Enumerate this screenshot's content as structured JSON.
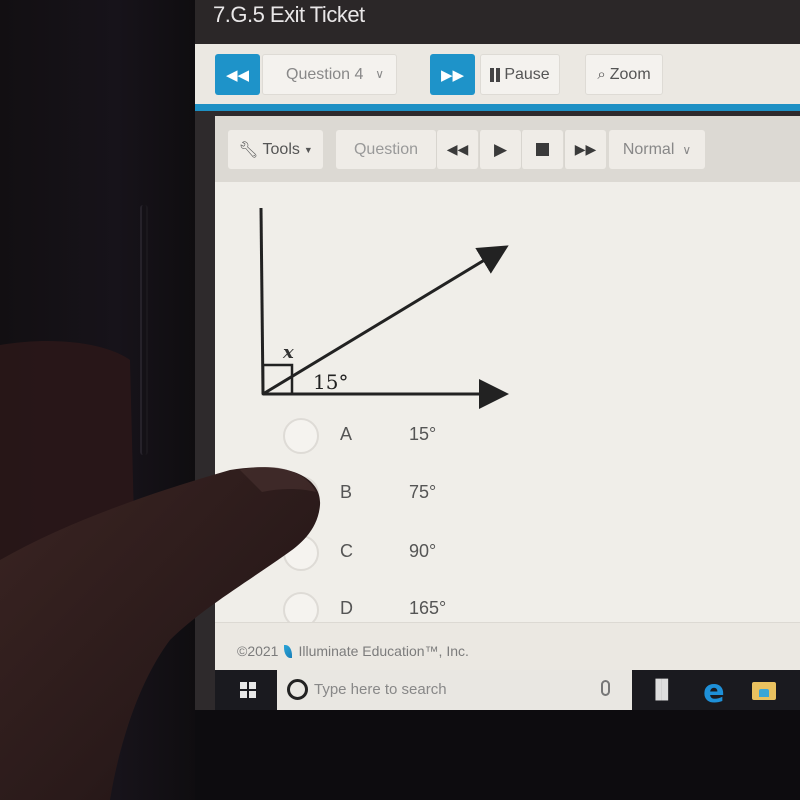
{
  "window": {
    "title": "7.G.5 Exit Ticket"
  },
  "nav": {
    "prev_icon": "double-left-arrow",
    "question_select": "Question 4",
    "next_icon": "double-right-arrow",
    "pause_label": "Pause",
    "zoom_label": "Zoom"
  },
  "toolbar": {
    "tools_label": "Tools",
    "question_label": "Question",
    "rewind_icon": "◀◀",
    "play_icon": "▶",
    "fast_forward_icon": "▶▶",
    "speed_select": "Normal"
  },
  "question": {
    "diagram": {
      "unknown_label": "x",
      "given_angle_label": "15°",
      "right_angle_marker": true
    },
    "choices": [
      {
        "letter": "A",
        "value": "15°"
      },
      {
        "letter": "B",
        "value": "75°"
      },
      {
        "letter": "C",
        "value": "90°"
      },
      {
        "letter": "D",
        "value": "165°"
      }
    ]
  },
  "footer": {
    "copyright": "©2021",
    "company": "Illuminate Education™, Inc."
  },
  "taskbar": {
    "search_placeholder": "Type here to search"
  },
  "colors": {
    "accent": "#1e93c9",
    "title_bg": "#2b2728",
    "content_bg": "#f0eee9"
  }
}
